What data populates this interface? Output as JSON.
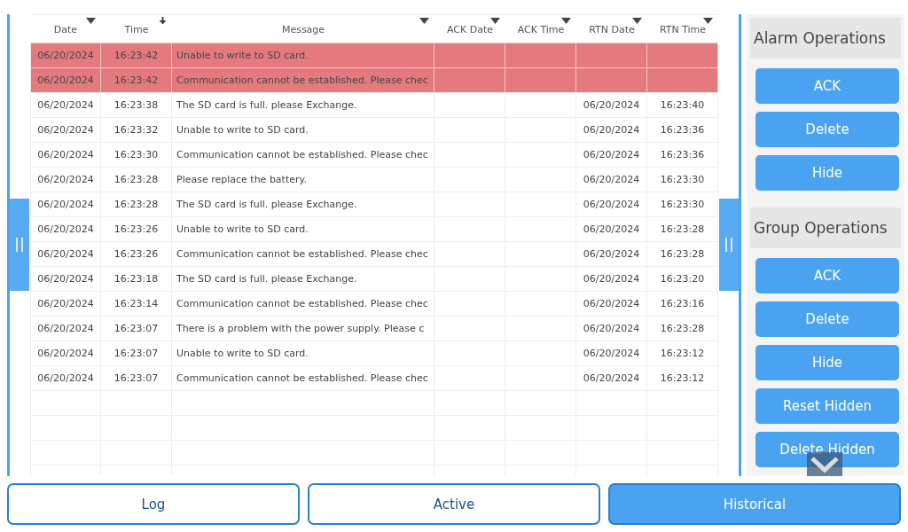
{
  "table": {
    "columns": [
      {
        "label": "Date",
        "sorted": false
      },
      {
        "label": "Time",
        "sorted": true
      },
      {
        "label": "Message",
        "sorted": false
      },
      {
        "label": "ACK Date",
        "sorted": false
      },
      {
        "label": "ACK Time",
        "sorted": false
      },
      {
        "label": "RTN Date",
        "sorted": false
      },
      {
        "label": "RTN Time",
        "sorted": false
      }
    ],
    "rows": [
      {
        "active": true,
        "cells": [
          "06/20/2024",
          "16:23:42",
          "Unable to write to SD card.",
          "",
          "",
          "",
          ""
        ]
      },
      {
        "active": true,
        "cells": [
          "06/20/2024",
          "16:23:42",
          "Communication cannot be established. Please chec",
          "",
          "",
          "",
          ""
        ]
      },
      {
        "active": false,
        "cells": [
          "06/20/2024",
          "16:23:38",
          "The SD card is full. please Exchange.",
          "",
          "",
          "06/20/2024",
          "16:23:40"
        ]
      },
      {
        "active": false,
        "cells": [
          "06/20/2024",
          "16:23:32",
          "Unable to write to SD card.",
          "",
          "",
          "06/20/2024",
          "16:23:36"
        ]
      },
      {
        "active": false,
        "cells": [
          "06/20/2024",
          "16:23:30",
          "Communication cannot be established. Please chec",
          "",
          "",
          "06/20/2024",
          "16:23:36"
        ]
      },
      {
        "active": false,
        "cells": [
          "06/20/2024",
          "16:23:28",
          "Please replace the battery.",
          "",
          "",
          "06/20/2024",
          "16:23:30"
        ]
      },
      {
        "active": false,
        "cells": [
          "06/20/2024",
          "16:23:28",
          "The SD card is full. please Exchange.",
          "",
          "",
          "06/20/2024",
          "16:23:30"
        ]
      },
      {
        "active": false,
        "cells": [
          "06/20/2024",
          "16:23:26",
          "Unable to write to SD card.",
          "",
          "",
          "06/20/2024",
          "16:23:28"
        ]
      },
      {
        "active": false,
        "cells": [
          "06/20/2024",
          "16:23:26",
          "Communication cannot be established. Please chec",
          "",
          "",
          "06/20/2024",
          "16:23:28"
        ]
      },
      {
        "active": false,
        "cells": [
          "06/20/2024",
          "16:23:18",
          "The SD card is full. please Exchange.",
          "",
          "",
          "06/20/2024",
          "16:23:20"
        ]
      },
      {
        "active": false,
        "cells": [
          "06/20/2024",
          "16:23:14",
          "Communication cannot be established. Please chec",
          "",
          "",
          "06/20/2024",
          "16:23:16"
        ]
      },
      {
        "active": false,
        "cells": [
          "06/20/2024",
          "16:23:07",
          "There is a problem with the power supply. Please c",
          "",
          "",
          "06/20/2024",
          "16:23:28"
        ]
      },
      {
        "active": false,
        "cells": [
          "06/20/2024",
          "16:23:07",
          "Unable to write to SD card.",
          "",
          "",
          "06/20/2024",
          "16:23:12"
        ]
      },
      {
        "active": false,
        "cells": [
          "06/20/2024",
          "16:23:07",
          "Communication cannot be established. Please chec",
          "",
          "",
          "06/20/2024",
          "16:23:12"
        ]
      }
    ]
  },
  "panel": {
    "sections": [
      {
        "title": "Alarm Operations",
        "buttons": [
          "ACK",
          "Delete",
          "Hide"
        ]
      },
      {
        "title": "Group Operations",
        "buttons": [
          "ACK",
          "Delete",
          "Hide",
          "Reset Hidden",
          "Delete Hidden"
        ]
      }
    ]
  },
  "tabs": [
    {
      "label": "Log",
      "selected": false
    },
    {
      "label": "Active",
      "selected": false
    },
    {
      "label": "Historical",
      "selected": true
    }
  ]
}
